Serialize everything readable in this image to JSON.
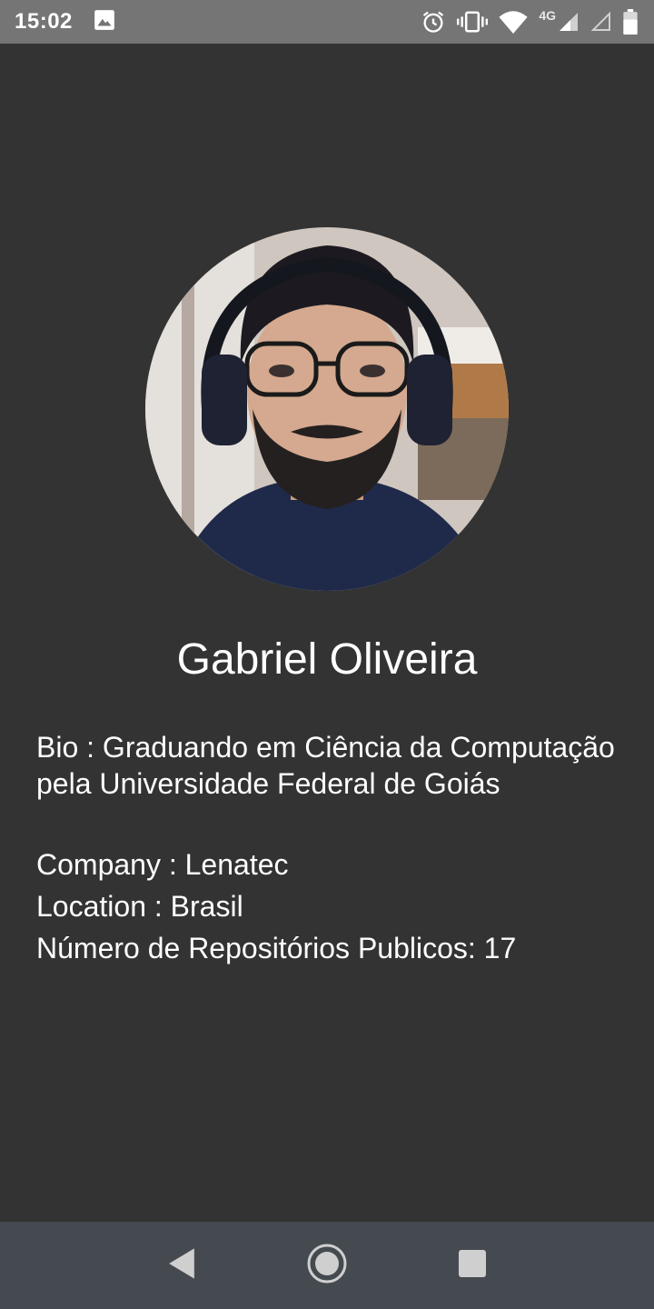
{
  "status_bar": {
    "time": "15:02",
    "network_type": "4G",
    "icons": [
      "image-icon",
      "alarm-icon",
      "vibrate-icon",
      "wifi-icon",
      "signal-icon",
      "signal-empty-icon",
      "battery-icon"
    ]
  },
  "profile": {
    "name": "Gabriel Oliveira",
    "avatar_icon": "profile-photo",
    "bio_label": "Bio : ",
    "bio": "Graduando em Ciência da Computação pela Universidade Federal de Goiás",
    "company_label": "Company : ",
    "company": "Lenatec",
    "location_label": "Location : ",
    "location": "Brasil",
    "repos_label": "Número de Repositórios Publicos: ",
    "repos_count": "17"
  },
  "nav_bar": {
    "icons": [
      "back-icon",
      "home-icon",
      "recents-icon"
    ]
  },
  "colors": {
    "background": "#333333",
    "status_bar": "#757575",
    "nav_bar": "#454a50",
    "text": "#ffffff"
  }
}
